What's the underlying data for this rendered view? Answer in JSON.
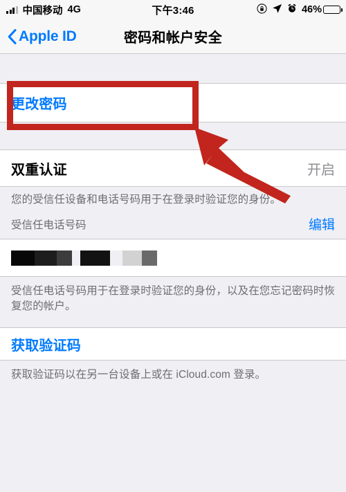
{
  "status_bar": {
    "carrier": "中国移动",
    "network_type": "4G",
    "time": "下午3:46",
    "battery_percent": "46%",
    "battery_level": 46,
    "icons": [
      "signal-bars-icon",
      "rotation-lock-icon",
      "location-arrow-icon",
      "alarm-clock-icon",
      "battery-icon"
    ]
  },
  "nav": {
    "back_label": "Apple ID",
    "title": "密码和帐户安全"
  },
  "sections": {
    "change_password": {
      "label": "更改密码"
    },
    "two_factor": {
      "title": "双重认证",
      "value": "开启",
      "description": "您的受信任设备和电话号码用于在登录时验证您的身份。",
      "trusted_label": "受信任电话号码",
      "edit_label": "编辑",
      "phone_number_redacted": true,
      "footer": "受信任电话号码用于在登录时验证您的身份，以及在您忘记密码时恢复您的帐户。"
    },
    "verification_code": {
      "label": "获取验证码",
      "footer": "获取验证码以在另一台设备上或在 iCloud.com 登录。"
    }
  },
  "annotations": {
    "highlight_target": "更改密码",
    "box_color": "#c1251d",
    "arrow_color": "#c1251d"
  }
}
